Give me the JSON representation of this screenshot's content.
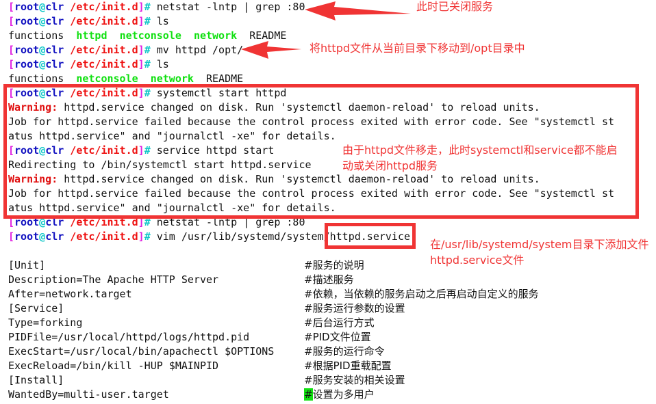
{
  "prompt": {
    "open": "[",
    "user": "root",
    "at": "@",
    "host": "clr",
    "path": "/etc/init.d",
    "close": "]",
    "hash": "# "
  },
  "lines": [
    {
      "prompt": true,
      "cmd": "netstat -lntp | grep :80"
    },
    {
      "prompt": true,
      "cmd": "ls"
    },
    {
      "segs": [
        [
          "n",
          "functions  "
        ],
        [
          "g",
          "httpd"
        ],
        [
          "n",
          "  "
        ],
        [
          "g",
          "netconsole"
        ],
        [
          "n",
          "  "
        ],
        [
          "g",
          "network"
        ],
        [
          "n",
          "  README"
        ]
      ]
    },
    {
      "prompt": true,
      "cmd": "mv httpd /opt/"
    },
    {
      "prompt": true,
      "cmd": "ls"
    },
    {
      "segs": [
        [
          "n",
          "functions  "
        ],
        [
          "g",
          "netconsole"
        ],
        [
          "n",
          "  "
        ],
        [
          "g",
          "network"
        ],
        [
          "n",
          "  README"
        ]
      ]
    },
    {
      "prompt": true,
      "cmd": "systemctl start httpd"
    },
    {
      "segs": [
        [
          "w",
          "Warning:"
        ],
        [
          "n",
          " httpd.service changed on disk. Run 'systemctl daemon-reload' to reload units."
        ]
      ]
    },
    {
      "segs": [
        [
          "n",
          "Job for httpd.service failed because the control process exited with error code. See \"systemctl st"
        ]
      ]
    },
    {
      "segs": [
        [
          "n",
          "atus httpd.service\" and \"journalctl -xe\" for details."
        ]
      ]
    },
    {
      "prompt": true,
      "cmd": "service httpd start"
    },
    {
      "segs": [
        [
          "n",
          "Redirecting to /bin/systemctl start httpd.service"
        ]
      ]
    },
    {
      "segs": [
        [
          "w",
          "Warning:"
        ],
        [
          "n",
          " httpd.service changed on disk. Run 'systemctl daemon-reload' to reload units."
        ]
      ]
    },
    {
      "segs": [
        [
          "n",
          "Job for httpd.service failed because the control process exited with error code. See \"systemctl st"
        ]
      ]
    },
    {
      "segs": [
        [
          "n",
          "atus httpd.service\" and \"journalctl -xe\" for details."
        ]
      ]
    },
    {
      "prompt": true,
      "cmd": "netstat -lntp | grep :80"
    },
    {
      "prompt": true,
      "cmd": "vim /usr/lib/systemd/system/httpd.service"
    },
    {
      "segs": []
    },
    {
      "segs": [
        [
          "n",
          "[Unit]"
        ]
      ],
      "comment": "#服务的说明"
    },
    {
      "segs": [
        [
          "n",
          "Description=The Apache HTTP Server"
        ]
      ],
      "comment": "#描述服务"
    },
    {
      "segs": [
        [
          "n",
          "After=network.target"
        ]
      ],
      "comment": "#依赖，当依赖的服务启动之后再启动自定义的服务"
    },
    {
      "segs": [
        [
          "n",
          "[Service]"
        ]
      ],
      "comment": "#服务运行参数的设置"
    },
    {
      "segs": [
        [
          "n",
          "Type=forking"
        ]
      ],
      "comment": "#后台运行方式"
    },
    {
      "segs": [
        [
          "n",
          "PIDFile=/usr/local/httpd/logs/httpd.pid"
        ]
      ],
      "comment": "#PID文件位置"
    },
    {
      "segs": [
        [
          "n",
          "ExecStart=/usr/local/bin/apachectl $OPTIONS"
        ]
      ],
      "comment": "#服务的运行命令"
    },
    {
      "segs": [
        [
          "n",
          "ExecReload=/bin/kill -HUP $MAINPID"
        ]
      ],
      "comment": "#根据PID重载配置"
    },
    {
      "segs": [
        [
          "n",
          "[Install]"
        ]
      ],
      "comment": "#服务安装的相关设置"
    },
    {
      "segs": [
        [
          "n",
          "WantedBy=multi-user.target"
        ]
      ],
      "comment": "#设置为多用户",
      "cursor": true
    }
  ],
  "annotations": {
    "closed": "此时已关闭服务",
    "moved": "将httpd文件从当前目录下移动到/opt目录中",
    "cannot_start": "由于httpd文件移走，此时systemctl和service都不能启动或关闭httpd服务",
    "add_file": "在/usr/lib/systemd/system目录下添加文件httpd.service文件"
  },
  "colors": {
    "annotation": "#f03434",
    "prompt_path": "#ee1010",
    "green": "#10e010"
  }
}
